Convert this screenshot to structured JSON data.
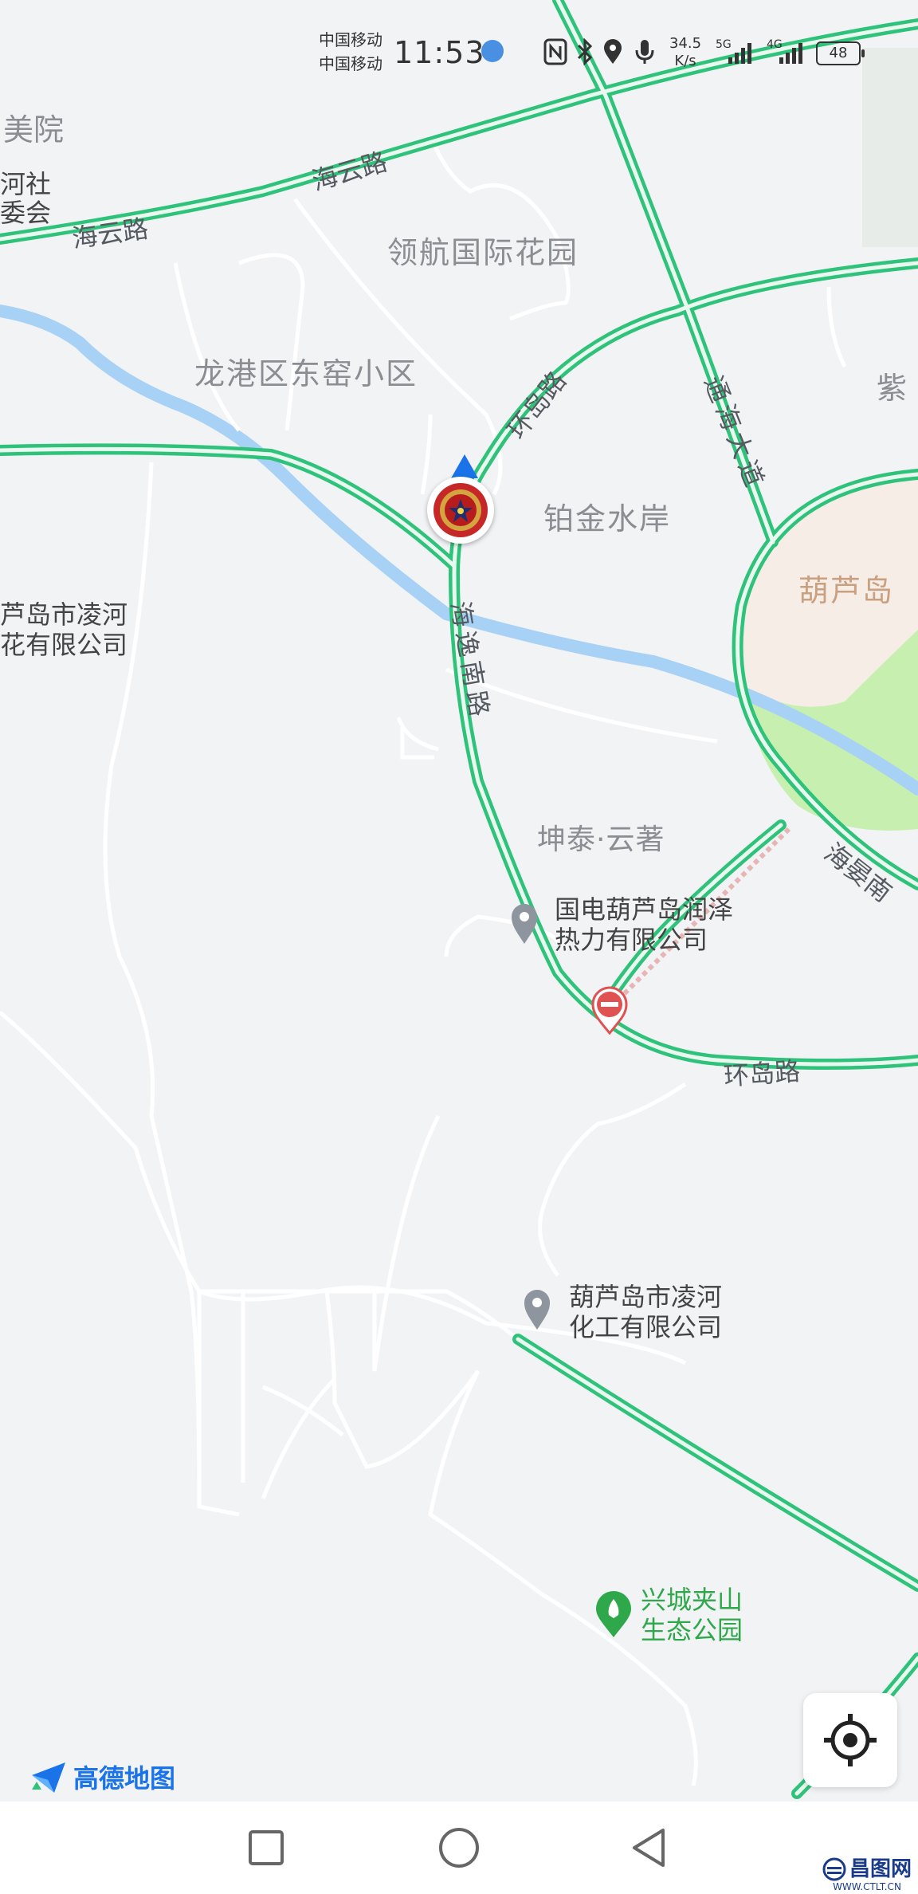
{
  "status_bar": {
    "carrier1": "中国移动",
    "carrier2": "中国移动",
    "time": "11:53",
    "net_speed_value": "34.5",
    "net_speed_unit": "K/s",
    "signal1_type": "5G",
    "signal2_type": "4G",
    "battery": "48"
  },
  "map": {
    "area_labels": {
      "meiyuan": "美院",
      "hezhe1": "河社",
      "hezhe2": "委会",
      "linghang": "领航国际花园",
      "donggang": "龙港区东窑小区",
      "bojin": "铂金水岸",
      "kuntai": "坤泰·云著",
      "zi": "紫",
      "huludao": "葫芦岛"
    },
    "road_labels": {
      "haiyun_1": "海云路",
      "haiyun_2": "海云路",
      "huandao_1": "环岛路",
      "huandao_2": "环岛路",
      "tonghai": "通海大道",
      "haiyinan": "海逸南路",
      "haiyan": "海晏南"
    },
    "pois": {
      "linghe_left_1": "芦岛市凌河",
      "linghe_left_2": "花有限公司",
      "guodian_1": "国电葫芦岛润泽",
      "guodian_2": "热力有限公司",
      "huagong_1": "葫芦岛市凌河",
      "huagong_2": "化工有限公司",
      "park_1": "兴城夹山",
      "park_2": "生态公园"
    }
  },
  "branding": {
    "logo": "高德地图"
  },
  "watermark": {
    "main": "昌图网",
    "sub": "WWW.CTLT.CN"
  },
  "colors": {
    "map_bg": "#f2f3f5",
    "road_green": "#2fc27a",
    "river": "#a8d2f5",
    "park": "#c6efb0",
    "city_zone": "#f6ede6",
    "accent_blue": "#1a73e8"
  },
  "icons": {
    "location_marker": "police-badge-icon",
    "locate": "crosshair-icon"
  }
}
